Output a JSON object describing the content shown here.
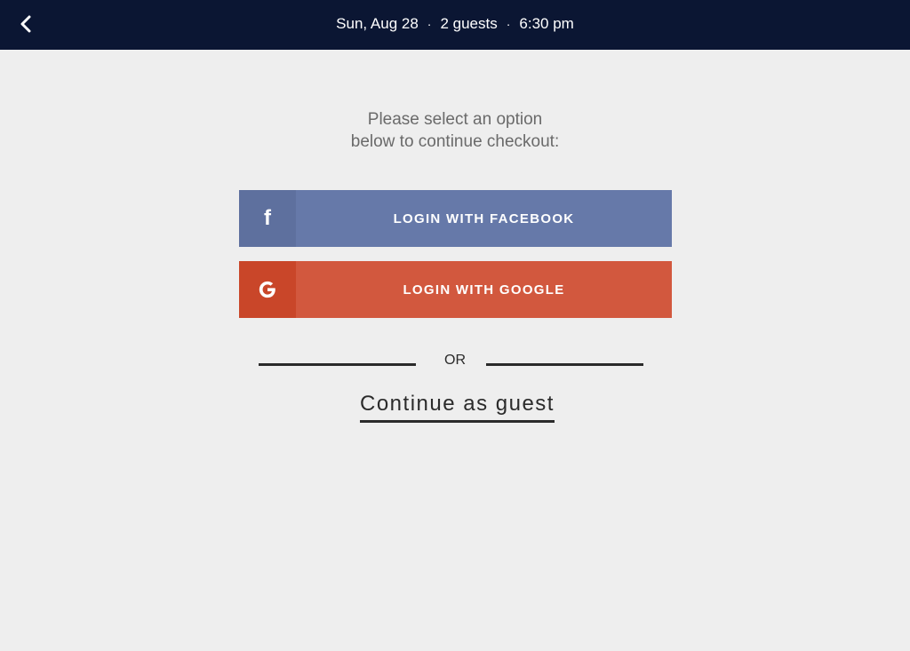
{
  "header": {
    "back_icon": "chevron-left-icon",
    "date": "Sun, Aug 28",
    "separator": "·",
    "guests": "2 guests",
    "time": "6:30 pm"
  },
  "prompt": {
    "line1": "Please select an option",
    "line2": "below to continue checkout:"
  },
  "facebook_button": {
    "icon": "facebook-icon",
    "icon_glyph": "f",
    "label": "LOGIN WITH FACEBOOK",
    "color": "#6679a9"
  },
  "google_button": {
    "icon": "google-icon",
    "label": "LOGIN WITH GOOGLE",
    "color": "#d2583e"
  },
  "divider": {
    "label": "OR"
  },
  "guest_link": {
    "label": "Continue as guest"
  },
  "colors": {
    "header_bg": "#0b1633",
    "page_bg": "#eeeeee"
  }
}
